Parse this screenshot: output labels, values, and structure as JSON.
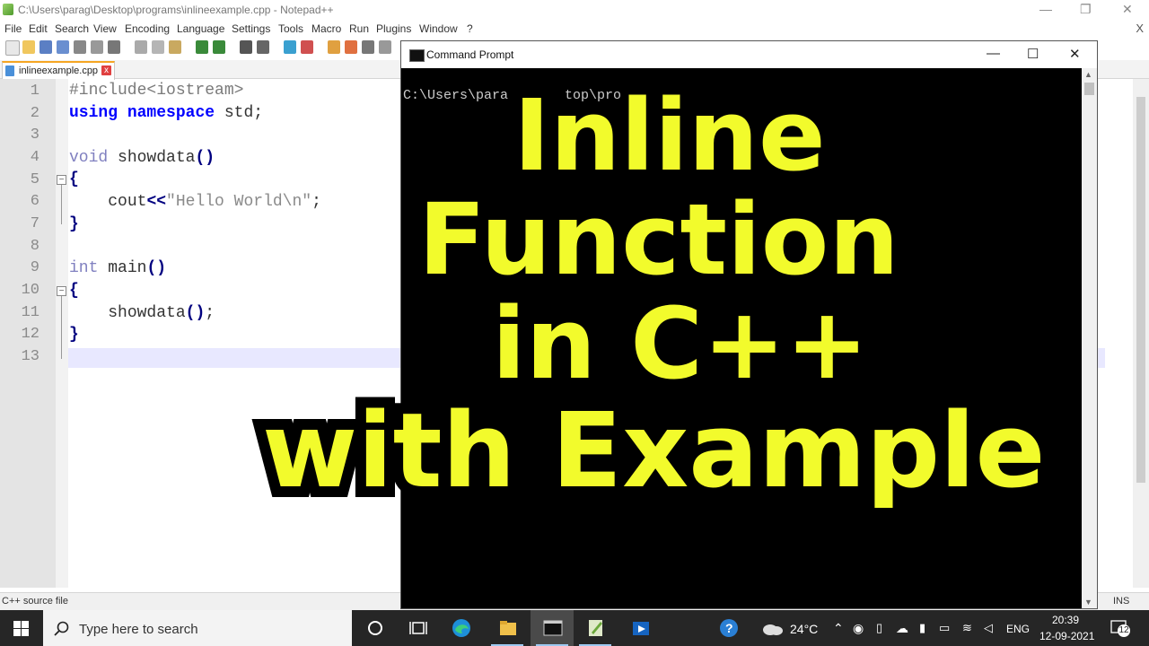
{
  "npp": {
    "title": "C:\\Users\\parag\\Desktop\\programs\\inlineexample.cpp - Notepad++",
    "menu": [
      "File",
      "Edit",
      "Search",
      "View",
      "Encoding",
      "Language",
      "Settings",
      "Tools",
      "Macro",
      "Run",
      "Plugins",
      "Window",
      "?"
    ],
    "close_x": "X",
    "tab": {
      "label": "inlineexample.cpp",
      "close": "x"
    },
    "line_numbers": [
      "1",
      "2",
      "3",
      "4",
      "5",
      "6",
      "7",
      "8",
      "9",
      "10",
      "11",
      "12",
      "13"
    ],
    "code": {
      "l1": "#include<iostream>",
      "l2_kw1": "using",
      "l2_kw2": "namespace",
      "l2_rest": "std;",
      "l4_kw": "void",
      "l4_fn": "showdata",
      "l4_par": "()",
      "l5": "{",
      "l6_fn": "cout",
      "l6_op": "<<",
      "l6_str": "\"Hello World\\n\"",
      "l6_end": ";",
      "l7": "}",
      "l9_kw": "int",
      "l9_fn": "main",
      "l9_par": "()",
      "l10": "{",
      "l11_fn": "showdata",
      "l11_par": "()",
      "l11_end": ";",
      "l12": "}"
    },
    "status_left": "C++ source file",
    "status_right": "INS"
  },
  "cmd": {
    "title": "Command Prompt",
    "minimize": "—",
    "maximize": "☐",
    "close": "✕",
    "line": "C:\\Users\\para       top\\pro"
  },
  "overlay": {
    "line1": "Inline",
    "line2": "Function",
    "line3": "in C++",
    "line4": "with Example"
  },
  "taskbar": {
    "search_placeholder": "Type here to search",
    "temperature": "24°C",
    "language": "ENG",
    "time": "20:39",
    "date": "12-09-2021",
    "notifications": "12"
  },
  "colors": {
    "overlay_text": "#f2fb2c",
    "keyword_bold": "#0000ff",
    "keyword_type": "#8080c0",
    "taskbar": "#262626"
  }
}
